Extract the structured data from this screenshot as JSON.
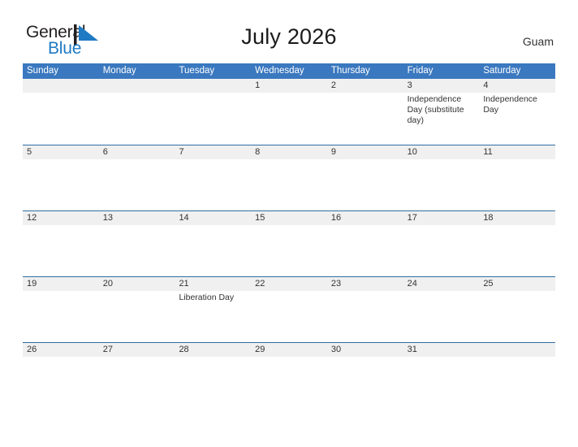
{
  "brand": {
    "name_part1": "General",
    "name_part2": "Blue",
    "mark": "triangle-logo"
  },
  "title": "July 2026",
  "region": "Guam",
  "colors": {
    "header_blue": "#3a78bf",
    "rule_blue": "#2e6da4",
    "daynum_band": "#f0f0f0",
    "brand_blue": "#1f7ac4",
    "text": "#333333"
  },
  "weekdays": [
    "Sunday",
    "Monday",
    "Tuesday",
    "Wednesday",
    "Thursday",
    "Friday",
    "Saturday"
  ],
  "weeks": [
    [
      {
        "day": "",
        "events": []
      },
      {
        "day": "",
        "events": []
      },
      {
        "day": "",
        "events": []
      },
      {
        "day": "1",
        "events": []
      },
      {
        "day": "2",
        "events": []
      },
      {
        "day": "3",
        "events": [
          "Independence Day (substitute day)"
        ]
      },
      {
        "day": "4",
        "events": [
          "Independence Day"
        ]
      }
    ],
    [
      {
        "day": "5",
        "events": []
      },
      {
        "day": "6",
        "events": []
      },
      {
        "day": "7",
        "events": []
      },
      {
        "day": "8",
        "events": []
      },
      {
        "day": "9",
        "events": []
      },
      {
        "day": "10",
        "events": []
      },
      {
        "day": "11",
        "events": []
      }
    ],
    [
      {
        "day": "12",
        "events": []
      },
      {
        "day": "13",
        "events": []
      },
      {
        "day": "14",
        "events": []
      },
      {
        "day": "15",
        "events": []
      },
      {
        "day": "16",
        "events": []
      },
      {
        "day": "17",
        "events": []
      },
      {
        "day": "18",
        "events": []
      }
    ],
    [
      {
        "day": "19",
        "events": []
      },
      {
        "day": "20",
        "events": []
      },
      {
        "day": "21",
        "events": [
          "Liberation Day"
        ]
      },
      {
        "day": "22",
        "events": []
      },
      {
        "day": "23",
        "events": []
      },
      {
        "day": "24",
        "events": []
      },
      {
        "day": "25",
        "events": []
      }
    ],
    [
      {
        "day": "26",
        "events": []
      },
      {
        "day": "27",
        "events": []
      },
      {
        "day": "28",
        "events": []
      },
      {
        "day": "29",
        "events": []
      },
      {
        "day": "30",
        "events": []
      },
      {
        "day": "31",
        "events": []
      },
      {
        "day": "",
        "events": []
      }
    ]
  ]
}
